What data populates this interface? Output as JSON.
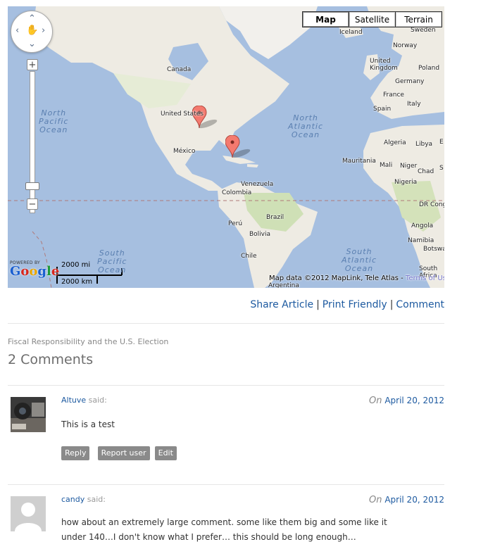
{
  "map": {
    "map_types": [
      "Map",
      "Satellite",
      "Terrain"
    ],
    "active_type": "Map",
    "labels": {
      "iceland": "Iceland",
      "sweden": "Sweden",
      "norway": "Norway",
      "united_kingdom": "United\nKingdom",
      "poland": "Poland",
      "germany": "Germany",
      "france": "France",
      "italy": "Italy",
      "spain": "Spain",
      "algeria": "Algeria",
      "libya": "Libya",
      "e": "E",
      "mauritania": "Mauritania",
      "mali": "Mali",
      "niger": "Niger",
      "chad": "Chad",
      "s": "S",
      "nigeria": "Nigeria",
      "drc": "DR Cong",
      "angola": "Angola",
      "namibia": "Namibia",
      "botswana": "Botswa",
      "south_africa": "South\nAfrica",
      "canada": "Canada",
      "united_states": "United States",
      "mexico": "México",
      "venezuela": "Venezuela",
      "colombia": "Colombia",
      "brazil": "Brazil",
      "peru": "Perú",
      "bolivia": "Bolivia",
      "chile": "Chile",
      "argentina": "Argentina",
      "north_pacific": "North\nPacific\nOcean",
      "north_atlantic": "North\nAtlantic\nOcean",
      "south_pacific": "South\nPacific\nOcean",
      "south_atlantic": "South\nAtlantic\nOcean"
    },
    "scale": {
      "miles": "2000 mi",
      "km": "2000 km"
    },
    "logo": {
      "powered": "POWERED BY",
      "word": "Google"
    },
    "attribution": {
      "text": "Map data ©2012 MapLink, Tele Atlas - ",
      "terms": "Terms of Use"
    },
    "icons": {
      "pan": "pan-control-icon",
      "marker": "map-marker-icon",
      "zoom_in": "zoom-in-icon",
      "zoom_out": "zoom-out-icon"
    }
  },
  "article_actions": {
    "share": "Share Article",
    "print": "Print Friendly",
    "comment": "Comment",
    "separator": "|"
  },
  "post_title": "Fiscal Responsibility and the U.S. Election",
  "comment_count": "2 Comments",
  "comments": [
    {
      "author": "Altuve",
      "said": "said:",
      "date_prefix": "On",
      "date": "April 20, 2012",
      "body": "This is a test",
      "buttons": {
        "reply": "Reply",
        "report": "Report user",
        "edit": "Edit"
      }
    },
    {
      "author": "candy",
      "said": "said:",
      "date_prefix": "On",
      "date": "April 20, 2012",
      "body": "how about an extremely large comment. some like them big and some like it under 140…I don't know what I prefer… this should be long enough…"
    }
  ],
  "colors": {
    "link": "#1d5aa0",
    "ocean": "#a6bfe0",
    "land": "#eeebe3",
    "button": "#8a8a8a",
    "marker": "#f47a6f"
  }
}
